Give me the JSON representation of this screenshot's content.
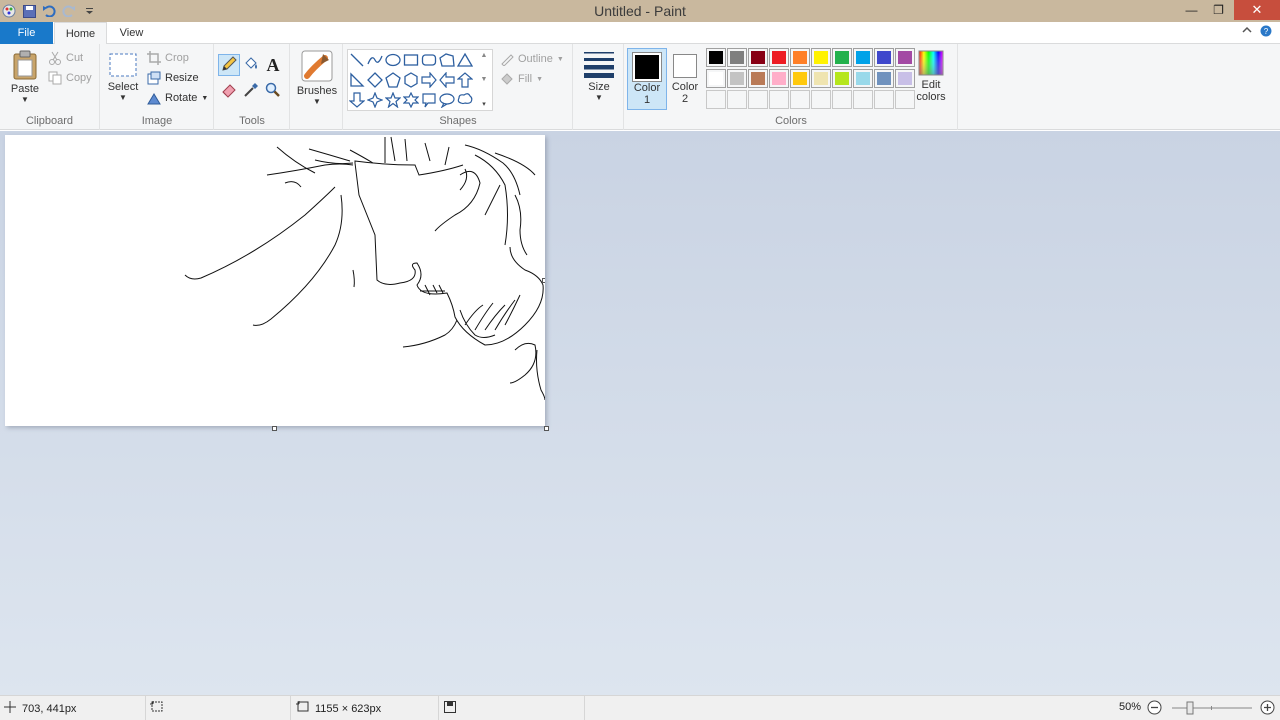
{
  "window": {
    "title": "Untitled - Paint",
    "minimize_glyph": "—",
    "restore_glyph": "❐",
    "close_glyph": "✕"
  },
  "tabs": {
    "file": "File",
    "home": "Home",
    "view": "View"
  },
  "clipboard": {
    "paste": "Paste",
    "cut": "Cut",
    "copy": "Copy",
    "label": "Clipboard"
  },
  "image": {
    "select": "Select",
    "crop": "Crop",
    "resize": "Resize",
    "rotate": "Rotate",
    "label": "Image"
  },
  "tools": {
    "label": "Tools",
    "active": "pencil"
  },
  "brushes": {
    "label": "Brushes"
  },
  "shapes": {
    "label": "Shapes",
    "outline": "Outline",
    "fill": "Fill"
  },
  "size": {
    "label": "Size"
  },
  "colors": {
    "label": "Colors",
    "color1_label": "Color",
    "color1_num": "1",
    "color2_label": "Color",
    "color2_num": "2",
    "color1": "#000000",
    "color2": "#ffffff",
    "edit_line1": "Edit",
    "edit_line2": "colors",
    "palette_row1": [
      "#000000",
      "#7f7f7f",
      "#880015",
      "#ed1c24",
      "#ff7f27",
      "#fff200",
      "#22b14c",
      "#00a2e8",
      "#3f48cc",
      "#a349a4"
    ],
    "palette_row2": [
      "#ffffff",
      "#c3c3c3",
      "#b97a57",
      "#ffaec9",
      "#ffc90e",
      "#efe4b0",
      "#b5e61d",
      "#99d9ea",
      "#7092be",
      "#c8bfe7"
    ]
  },
  "status": {
    "cursor_pos": "703, 441px",
    "dimensions": "1155 × 623px",
    "zoom": "50%"
  }
}
